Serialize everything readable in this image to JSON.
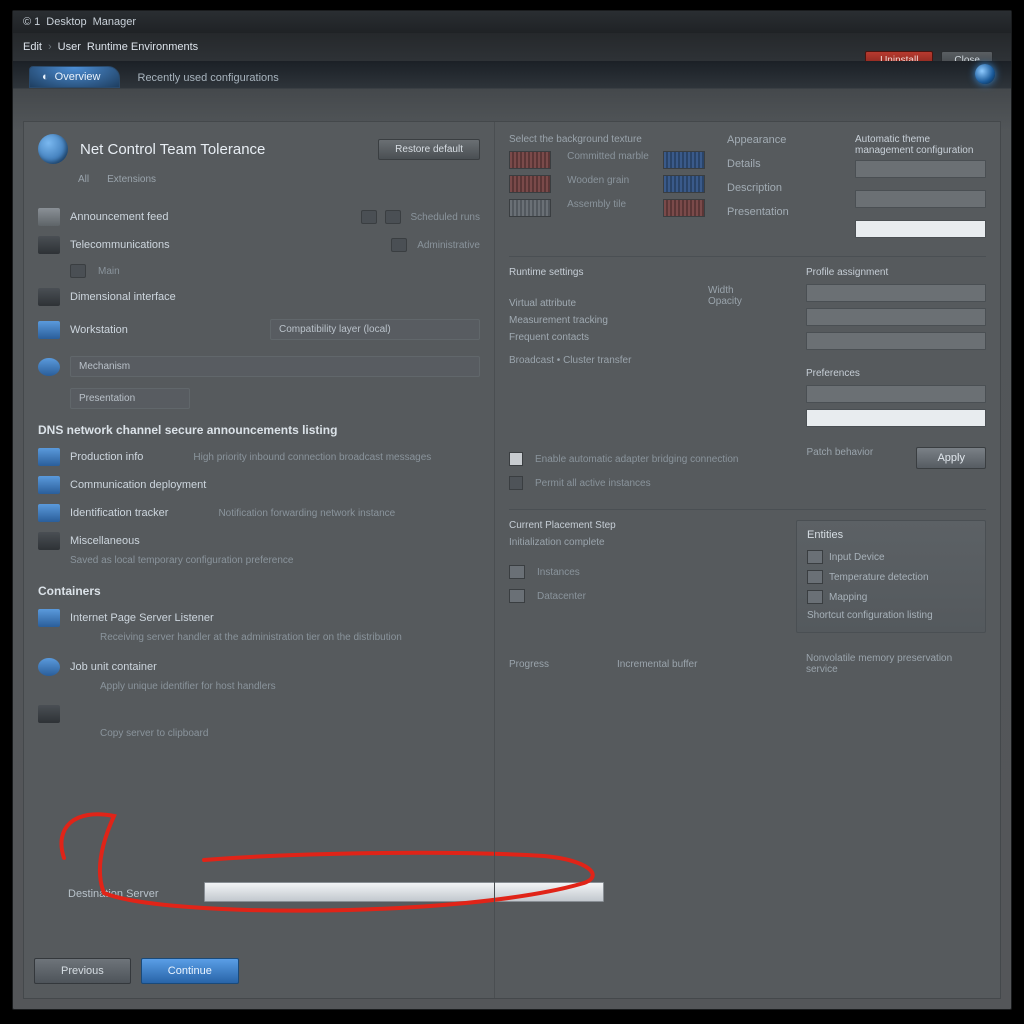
{
  "titlebar": {
    "prefix": "© 1",
    "app": "Desktop",
    "suffix": "Manager"
  },
  "breadcrumb": {
    "root": "Edit",
    "sep": "›",
    "path1": "User",
    "path2": "Runtime Environments"
  },
  "top_actions": {
    "danger": "Uninstall",
    "secondary": "Close"
  },
  "tabs": {
    "active": "Overview",
    "inactive": "Recently used configurations"
  },
  "left": {
    "header_title": "Net Control Team Tolerance",
    "header_button": "Restore default",
    "subheads": [
      "All",
      "Extensions"
    ],
    "row1": {
      "label": "Announcement feed",
      "r1": "Scheduled runs"
    },
    "row2": {
      "label": "Telecommunications",
      "r1": "Administrative",
      "r2": "Main"
    },
    "row3": {
      "label": "Dimensional interface"
    },
    "row4": {
      "label": "Workstation"
    },
    "band1": "Compatibility layer (local)",
    "row5": {
      "label": "Mechanism"
    },
    "band2": "Presentation",
    "sec1_title": "DNS network channel secure announcements listing",
    "sr1": {
      "label": "Production info",
      "desc": "High priority inbound connection broadcast messages"
    },
    "sr2": {
      "label": "Communication deployment"
    },
    "sr3": {
      "label": "Identification tracker",
      "desc": "Notification forwarding network instance"
    },
    "sr4": {
      "label": "Miscellaneous",
      "desc": "Saved as local temporary configuration preference"
    },
    "sec2_title": "Containers",
    "c1": {
      "label": "Internet Page Server Listener"
    },
    "c1_desc": "Receiving server handler at the administration tier on the distribution",
    "c2": {
      "label": "Job unit container"
    },
    "c2_desc": "Apply unique identifier for host handlers",
    "c3_desc": "Copy server to clipboard",
    "destination_label": "Destination Server"
  },
  "right": {
    "top_left_title": "Select the background texture",
    "thumbs": [
      {
        "label": "Committed marble"
      },
      {
        "label": "Wooden grain"
      },
      {
        "label": "Assembly tile"
      }
    ],
    "top_labels": {
      "a": "Appearance",
      "b": "Details",
      "c": "Description",
      "d": "Presentation"
    },
    "top_note": "Automatic theme management configuration",
    "mid_title": "Runtime settings",
    "mid_right_title": "Profile assignment",
    "kv1": "Virtual attribute",
    "kv1r_a": "Width",
    "kv1r_b": "Opacity",
    "kv2": "Measurement tracking",
    "kv3": "Frequent contacts",
    "mid_divider": "Broadcast • Cluster transfer",
    "mid_right2": "Preferences",
    "chk1": "Enable automatic adapter bridging connection",
    "chk2": "Permit all active instances",
    "chk_side": "Patch behavior",
    "apply": "Apply",
    "lower_left_title": "Current Placement Step",
    "lower_left_note": "Initialization complete",
    "tiles": {
      "a": "Instances",
      "b": "Datacenter"
    },
    "side_title": "Entities",
    "side1": "Input Device",
    "side2": "Temperature detection",
    "side3": "Mapping",
    "side4": "Shortcut configuration listing",
    "progress_label": "Progress",
    "progress_row": "Incremental buffer",
    "progress_note": "Nonvolatile memory preservation service"
  },
  "footer": {
    "back": "Previous",
    "next": "Continue"
  },
  "colors": {
    "accent": "#3a7ac6",
    "danger": "#b83a2f"
  }
}
